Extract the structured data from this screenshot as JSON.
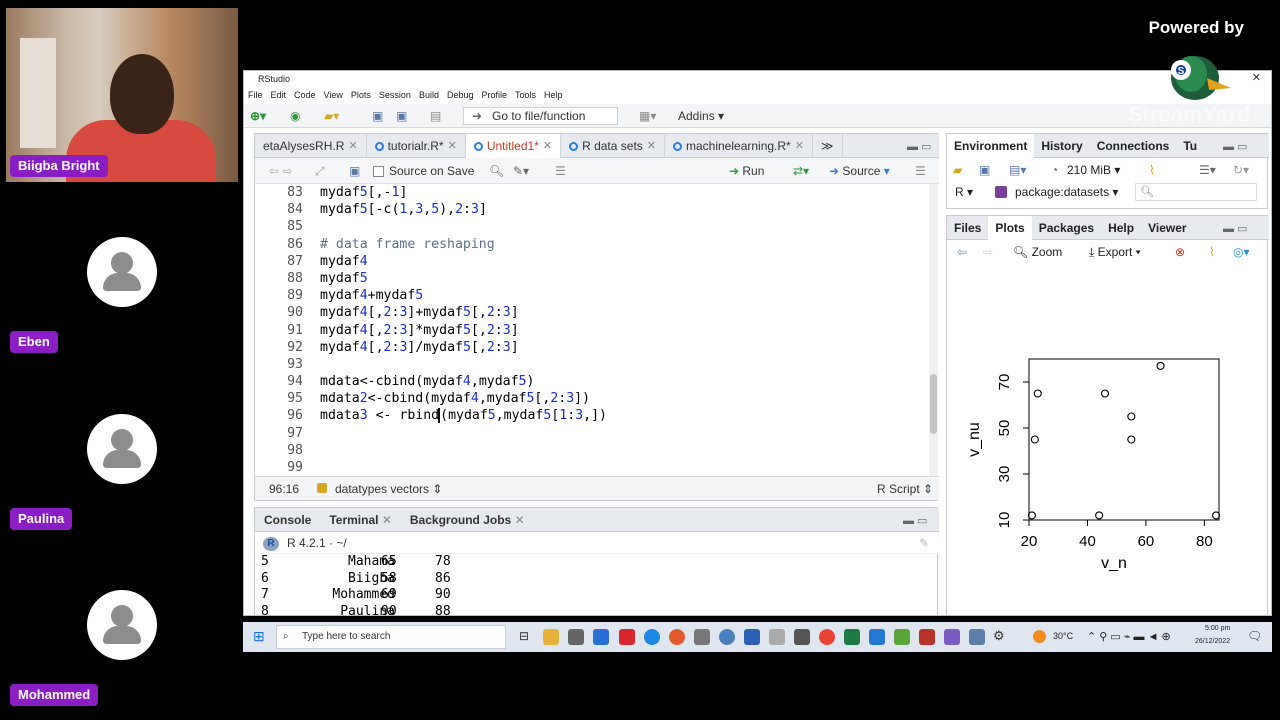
{
  "participants": [
    {
      "name": "Biigba Bright",
      "video": true
    },
    {
      "name": "Eben"
    },
    {
      "name": "Paulina"
    },
    {
      "name": "Mohammed"
    }
  ],
  "branding": {
    "powered_by": "Powered by",
    "watermark": "StreamYard"
  },
  "window": {
    "title": "RStudio"
  },
  "menu": [
    "File",
    "Edit",
    "Code",
    "View",
    "Plots",
    "Session",
    "Build",
    "Debug",
    "Profile",
    "Tools",
    "Help"
  ],
  "toolbar": {
    "goto_label": "Go to file/function",
    "addins_label": "Addins"
  },
  "editor": {
    "tabs": [
      {
        "label": "etaAlysesRH.R",
        "active": false
      },
      {
        "label": "tutorialr.R*",
        "active": false
      },
      {
        "label": "Untitled1*",
        "active": true
      },
      {
        "label": "R data sets",
        "active": false
      },
      {
        "label": "machinelearning.R*",
        "active": false
      }
    ],
    "source_on_save": "Source on Save",
    "run_label": "Run",
    "source_label": "Source",
    "lines": [
      {
        "n": "83",
        "t": "mydaf5[,-1]"
      },
      {
        "n": "84",
        "t": "mydaf5[-c(1,3,5),2:3]"
      },
      {
        "n": "85",
        "t": ""
      },
      {
        "n": "86",
        "t": "# data frame reshaping"
      },
      {
        "n": "87",
        "t": "mydaf4"
      },
      {
        "n": "88",
        "t": "mydaf5"
      },
      {
        "n": "89",
        "t": "mydaf4+mydaf5"
      },
      {
        "n": "90",
        "t": "mydaf4[,2:3]+mydaf5[,2:3]"
      },
      {
        "n": "91",
        "t": "mydaf4[,2:3]*mydaf5[,2:3]"
      },
      {
        "n": "92",
        "t": "mydaf4[,2:3]/mydaf5[,2:3]"
      },
      {
        "n": "93",
        "t": ""
      },
      {
        "n": "94",
        "t": "mdata<-cbind(mydaf4,mydaf5)"
      },
      {
        "n": "95",
        "t": "mdata2<-cbind(mydaf4,mydaf5[,2:3])"
      },
      {
        "n": "96",
        "t": "mdata3 <- rbind(mydaf5,mydaf5[1:3,])"
      },
      {
        "n": "97",
        "t": ""
      },
      {
        "n": "98",
        "t": ""
      },
      {
        "n": "99",
        "t": ""
      }
    ],
    "status": {
      "position": "96:16",
      "scope": "datatypes vectors",
      "filetype": "R Script"
    }
  },
  "console": {
    "tabs": [
      "Console",
      "Terminal",
      "Background Jobs"
    ],
    "r_version": "R 4.2.1 · ~/",
    "rows": [
      [
        "5",
        "Mahama",
        "65",
        "78"
      ],
      [
        "6",
        "Biigba",
        "58",
        "86"
      ],
      [
        "7",
        "Mohammed",
        "69",
        "90"
      ],
      [
        "8",
        "Paulina",
        "90",
        "88"
      ]
    ]
  },
  "environment": {
    "tabs": [
      "Environment",
      "History",
      "Connections",
      "Tu"
    ],
    "memory": "210 MiB",
    "r_scope": "R",
    "package": "package:datasets"
  },
  "files_pane": {
    "tabs": [
      "Files",
      "Plots",
      "Packages",
      "Help",
      "Viewer"
    ],
    "zoom_label": "Zoom",
    "export_label": "Export"
  },
  "chart_data": {
    "type": "scatter",
    "xlabel": "v_n",
    "ylabel": "v_nu",
    "xlim": [
      20,
      85
    ],
    "ylim": [
      10,
      80
    ],
    "xticks": [
      20,
      40,
      60,
      80
    ],
    "yticks": [
      10,
      30,
      50,
      70
    ],
    "points": [
      {
        "x": 21,
        "y": 12
      },
      {
        "x": 22,
        "y": 45
      },
      {
        "x": 23,
        "y": 65
      },
      {
        "x": 44,
        "y": 12
      },
      {
        "x": 46,
        "y": 65
      },
      {
        "x": 55,
        "y": 55
      },
      {
        "x": 55,
        "y": 45
      },
      {
        "x": 65,
        "y": 77
      },
      {
        "x": 84,
        "y": 12
      }
    ]
  },
  "taskbar": {
    "search_placeholder": "Type here to search",
    "temperature": "30°C",
    "time": "5:00 pm",
    "date": "26/12/2022"
  }
}
